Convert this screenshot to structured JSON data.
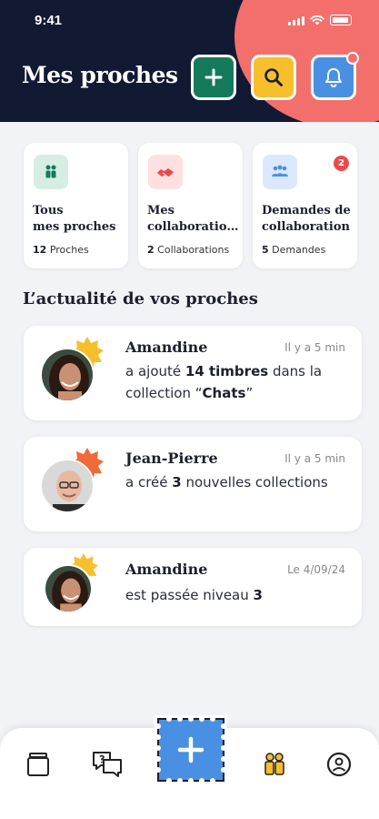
{
  "status_bar": {
    "time": "9:41"
  },
  "header": {
    "title": "Mes proches"
  },
  "quick_cards": [
    {
      "title_lines": [
        "Tous",
        "mes proches"
      ],
      "count": "12",
      "count_label": "Proches"
    },
    {
      "title_lines": [
        "Mes",
        "collaborations"
      ],
      "count": "2",
      "count_label": "Collaborations"
    },
    {
      "title_lines": [
        "Demandes de",
        "collaboration"
      ],
      "count": "5",
      "count_label": "Demandes",
      "badge": "2"
    }
  ],
  "feed": {
    "title": "L’actualité de vos proches",
    "items": [
      {
        "name": "Amandine",
        "time": "Il y a 5 min",
        "msg_pre": "a ajouté ",
        "msg_bold": "14 timbres",
        "msg_mid": " dans la collection “",
        "msg_bold2": "Chats",
        "msg_post": "”"
      },
      {
        "name": "Jean-Pierre",
        "time": "Il y a 5 min",
        "msg_pre": "a créé ",
        "msg_bold": "3",
        "msg_mid": " nouvelles collections",
        "msg_bold2": "",
        "msg_post": ""
      },
      {
        "name": "Amandine",
        "time": "Le 4/09/24",
        "msg_pre": "est passée niveau ",
        "msg_bold": "3",
        "msg_mid": "",
        "msg_bold2": "",
        "msg_post": ""
      }
    ]
  },
  "colors": {
    "header_bg": "#121933",
    "accent_coral": "#f26f6c",
    "green": "#157a5c",
    "yellow": "#f7bf2c",
    "blue": "#4a90e2"
  },
  "icons": {
    "header": [
      "plus-icon",
      "search-icon",
      "bell-icon"
    ],
    "nav": [
      "collection-icon",
      "chat-icon",
      "plus-icon",
      "people-icon",
      "profile-icon"
    ]
  }
}
